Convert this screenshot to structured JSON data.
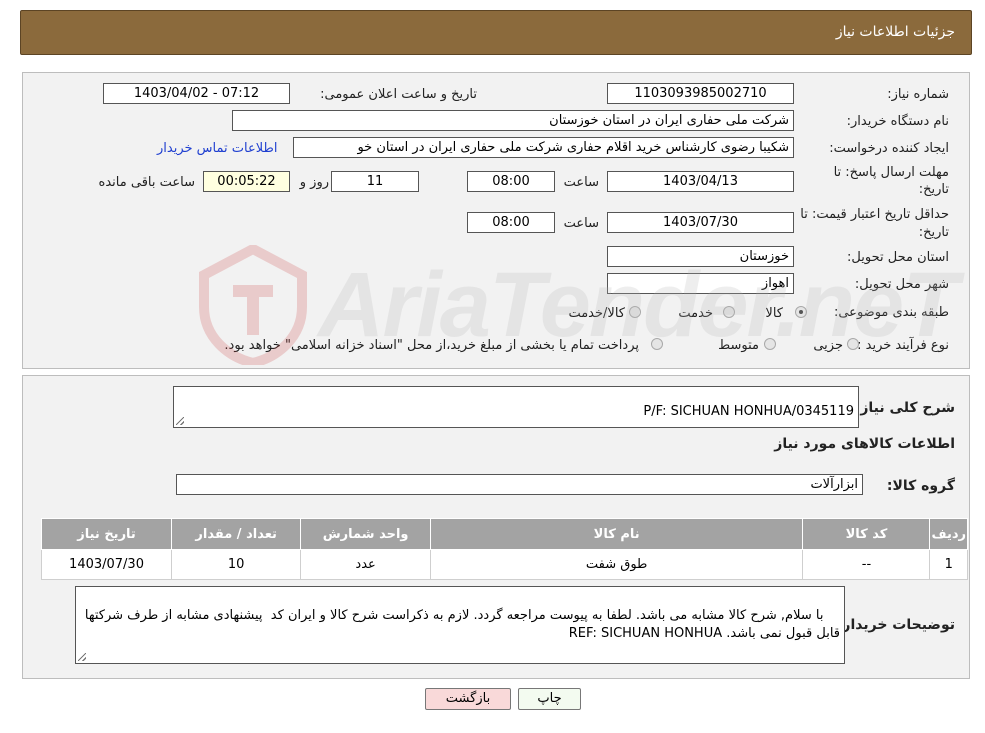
{
  "header": {
    "title": "جزئیات اطلاعات نیاز"
  },
  "form": {
    "need_number_label": "شماره نیاز:",
    "need_number": "1103093985002710",
    "announce_label": "تاریخ و ساعت اعلان عمومی:",
    "announce_value": "1403/04/02 - 07:12",
    "buyer_org_label": "نام دستگاه خریدار:",
    "buyer_org": "شرکت ملی حفاری ایران در استان خوزستان",
    "requester_label": "ایجاد کننده درخواست:",
    "requester": "شکیبا رضوی کارشناس خرید اقلام حفاری شرکت ملی حفاری ایران در استان خو",
    "contact_link": "اطلاعات تماس خریدار",
    "deadline_label_1": "مهلت ارسال پاسخ: تا",
    "deadline_label_2": "تاریخ:",
    "deadline_date": "1403/04/13",
    "time_label": "ساعت",
    "deadline_time": "08:00",
    "days_value": "11",
    "days_label": "روز و",
    "remaining_value": "00:05:22",
    "remaining_label": "ساعت باقی مانده",
    "validity_label_1": "حداقل تاریخ اعتبار قیمت: تا",
    "validity_label_2": "تاریخ:",
    "validity_date": "1403/07/30",
    "validity_time": "08:00",
    "province_label": "استان محل تحویل:",
    "province": "خوزستان",
    "city_label": "شهر محل تحویل:",
    "city": "اهواز",
    "category_label": "طبقه بندی موضوعی:",
    "category_options": [
      "کالا",
      "خدمت",
      "کالا/خدمت"
    ],
    "category_selected": "کالا",
    "purchase_type_label": "نوع فرآیند خرید :",
    "purchase_options": [
      "جزیی",
      "متوسط"
    ],
    "purchase_note": "پرداخت تمام یا بخشی از مبلغ خرید،از محل \"اسناد خزانه اسلامی\" خواهد بود."
  },
  "details": {
    "summary_label": "شرح کلی نیاز:",
    "summary_value": "P/F: SICHUAN HONHUA/0345119",
    "items_heading": "اطلاعات کالاهای مورد نیاز",
    "group_label": "گروه کالا:",
    "group_value": "ابزارآلات",
    "table": {
      "headers": [
        "ردیف",
        "کد کالا",
        "نام کالا",
        "واحد شمارش",
        "تعداد / مقدار",
        "تاریخ نیاز"
      ],
      "rows": [
        [
          "1",
          "--",
          "طوق شفت",
          "عدد",
          "10",
          "1403/07/30"
        ]
      ]
    },
    "buyer_notes_label": "توضیحات خریدار:",
    "buyer_notes": "با سلام, شرح کالا مشابه می باشد. لطفا به پیوست مراجعه گردد. لازم به ذکراست شرح کالا و ایران کد  پیشنهادی مشابه از طرف شرکتها قابل قبول نمی باشد. REF: SICHUAN HONHUA"
  },
  "buttons": {
    "print": "چاپ",
    "back": "بازگشت"
  },
  "watermark": "AriaTender.neT",
  "colors": {
    "header": "#8b6a3c",
    "link": "#1f3fd0",
    "table_header": "#a3a3a3",
    "back_button": "#f9d9d9"
  }
}
